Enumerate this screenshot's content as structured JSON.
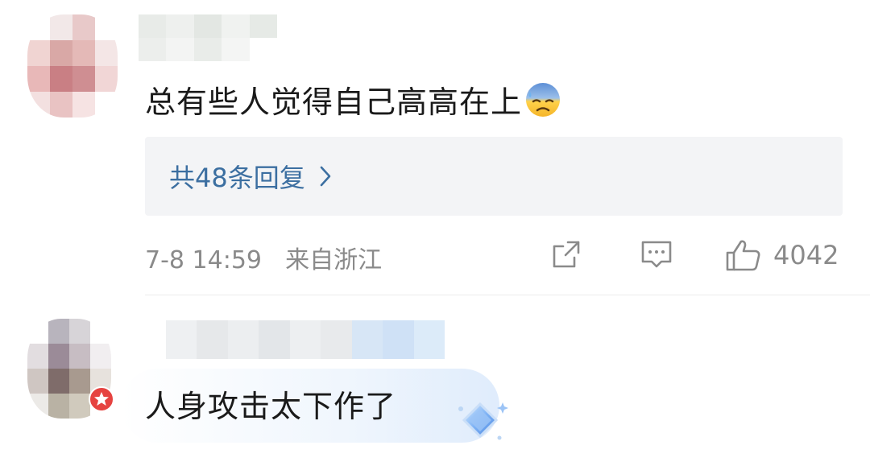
{
  "comments": [
    {
      "text": "总有些人觉得自己高高在上",
      "emoji": "anxious-sweat-face-emoji",
      "replies_label": "共48条回复",
      "timestamp": "7-8 14:59",
      "location": "来自浙江",
      "likes": "4042"
    },
    {
      "text": "人身攻击太下作了"
    }
  ],
  "colors": {
    "link": "#3c6fa1",
    "meta": "#8a8a8a",
    "reply_bg": "#f3f4f6"
  }
}
